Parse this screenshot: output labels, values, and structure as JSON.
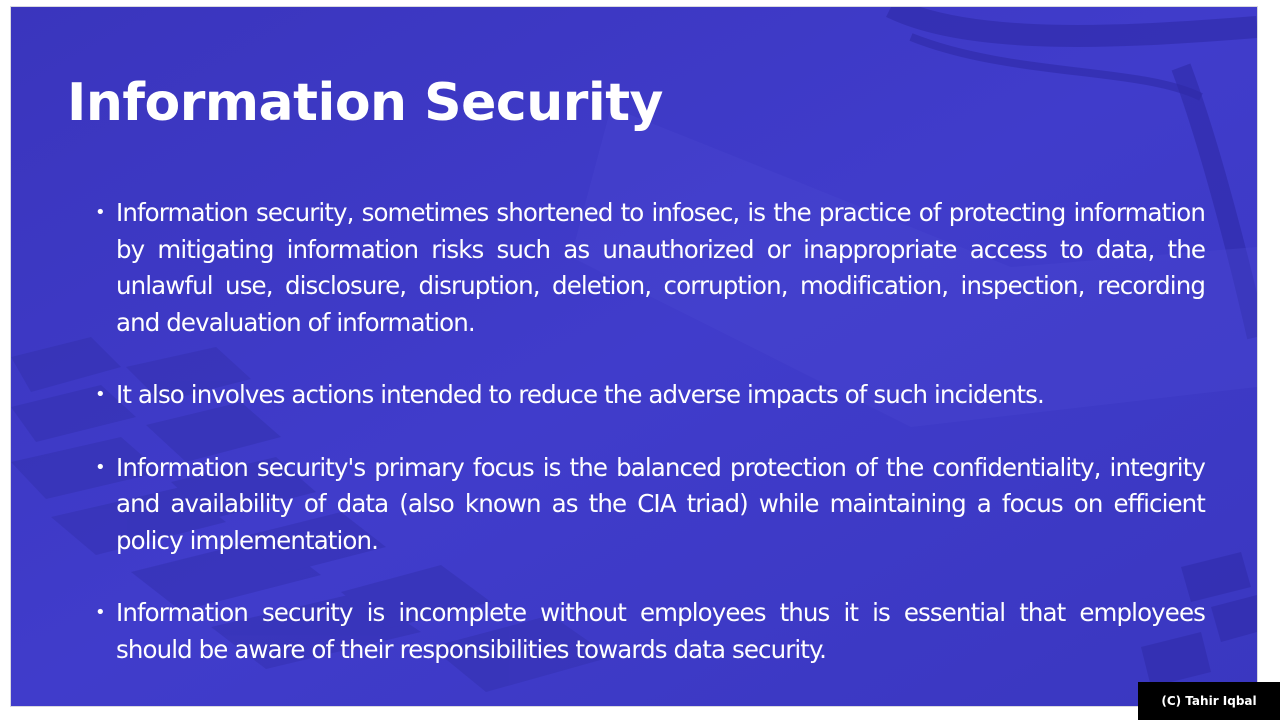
{
  "slide": {
    "title": "Information Security",
    "bullets": [
      {
        "text": "Information security, sometimes shortened to infosec, is the practice of protecting information by mitigating information risks such as unauthorized or inappropriate access to data, the unlawful use, disclosure, disruption, deletion, corruption, modification, inspection, recording and devaluation of information."
      },
      {
        "text": "It also involves actions intended to reduce the adverse impacts of such incidents."
      },
      {
        "text": "Information security's primary focus is the balanced protection of the confidentiality, integrity and availability of data (also known as the CIA triad) while maintaining a focus on efficient policy implementation."
      },
      {
        "text": "Information security is incomplete without employees thus it is essential that employees should be aware of their responsibilities towards data security."
      }
    ],
    "bullet_glyph": "•"
  },
  "watermark": {
    "copyright": "(C) Tahir Iqbal"
  },
  "colors": {
    "slide_background": "#3c38c2",
    "text": "#ffffff",
    "watermark_background": "#000000"
  }
}
